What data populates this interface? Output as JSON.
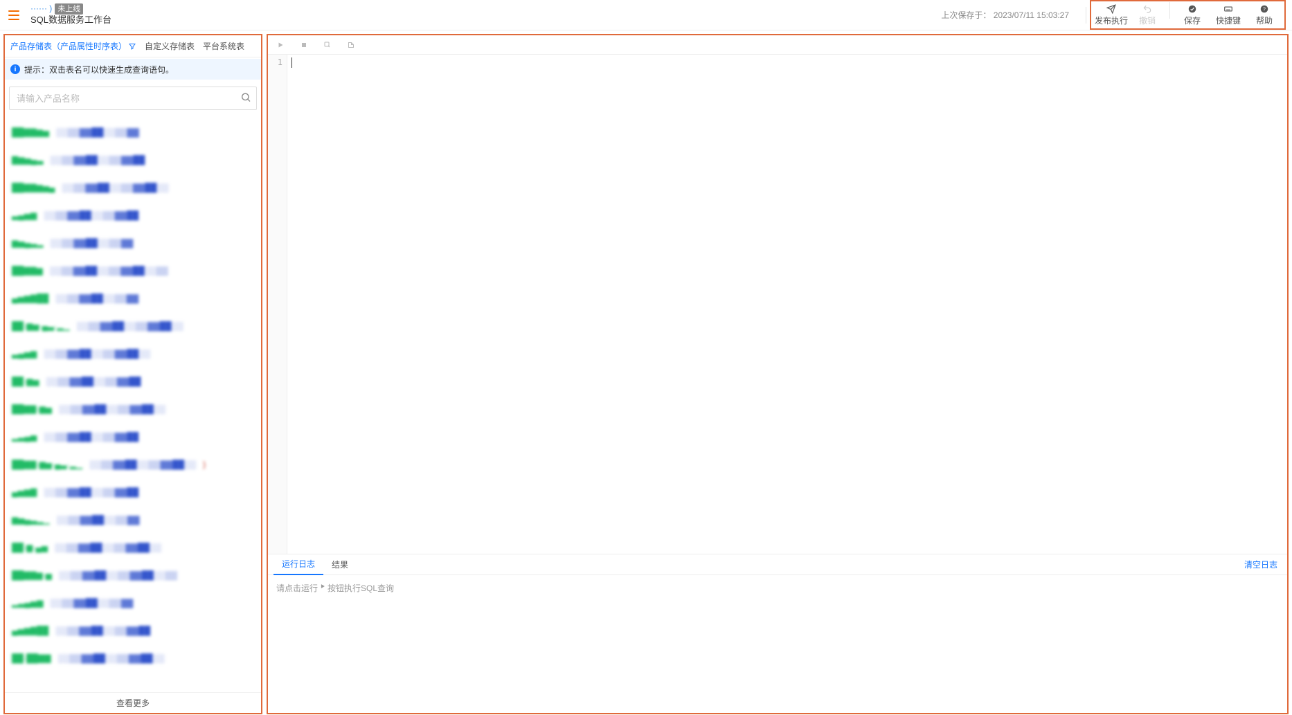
{
  "header": {
    "title_prefix": "······ )",
    "badge": "未上线",
    "subtitle": "SQL数据服务工作台",
    "last_saved_label": "上次保存于：",
    "last_saved_time": "2023/07/11 15:03:27",
    "actions": {
      "publish": "发布执行",
      "revoke": "撤销",
      "save": "保存",
      "shortcut": "快捷键",
      "help": "帮助"
    }
  },
  "sidebar": {
    "tabs": {
      "product": "产品存储表",
      "product_paren": "（产品属性时序表）",
      "custom": "自定义存储表",
      "platform": "平台系统表"
    },
    "hint": "提示：双击表名可以快速生成查询语句。",
    "search_placeholder": "请输入产品名称",
    "items": [
      "██▇▇▆▅  ░░▒▒▓▓██░░▒▒▓▓",
      "▇▆▅▄▃  ░░▒▒▓▓██░░▒▒▓▓██",
      "██▇▇▆▅▄  ░░▒▒▓▓██░░▒▒▓▓██░░",
      "▃▄▅▆  ░░▒▒▓▓██░░▒▒▓▓██",
      "▆▅▄▃▂  ░░▒▒▓▓██░░▒▒▓▓",
      "██▇▇▆  ░░▒▒▓▓██░░▒▒▓▓██░░▒▒",
      "▄▅▆▇██  ░░▒▒▓▓██░░▒▒▓▓",
      "██·▆▅·▄▃·▂▁  ░░▒▒▓▓██░░▒▒▓▓██░░",
      "▃▄▅▆  ░░▒▒▓▓██░░▒▒▓▓██░░",
      "██·▆▅  ░░▒▒▓▓██░░▒▒▓▓██",
      "██▇▇·▆▅  ░░▒▒▓▓██░░▒▒▓▓██░░",
      "▂▃▄▅  ░░▒▒▓▓██░░▒▒▓▓██",
      "██▇▇·▆▅·▄▃·▂▁  ░░▒▒▓▓██░░▒▒▓▓██░░  }",
      "▄▅▆▇  ░░▒▒▓▓██░░▒▒▓▓██",
      "▆▅▄▃▂▁  ░░▒▒▓▓██░░▒▒▓▓",
      "██·▆·▄▅  ░░▒▒▓▓██░░▒▒▓▓██░░",
      "██▇▇▆·▅  ░░▒▒▓▓██░░▒▒▓▓██░░▒▒",
      "▂▃▄▅▆  ░░▒▒▓▓██░░▒▒▓▓",
      "▄▅▆▇██  ░░▒▒▓▓██░░▒▒▓▓██",
      "██·██▇▇  ░░▒▒▓▓██░░▒▒▓▓██░░"
    ],
    "load_more": "查看更多"
  },
  "editor": {
    "line_number": "1",
    "tooltips": {
      "run": "运行",
      "stop": "停止",
      "format": "格式化",
      "clear": "清除"
    }
  },
  "results": {
    "tabs": {
      "log": "运行日志",
      "result": "结果"
    },
    "clear": "清空日志",
    "placeholder_pre": "请点击运行",
    "placeholder_post": "按钮执行SQL查询"
  }
}
